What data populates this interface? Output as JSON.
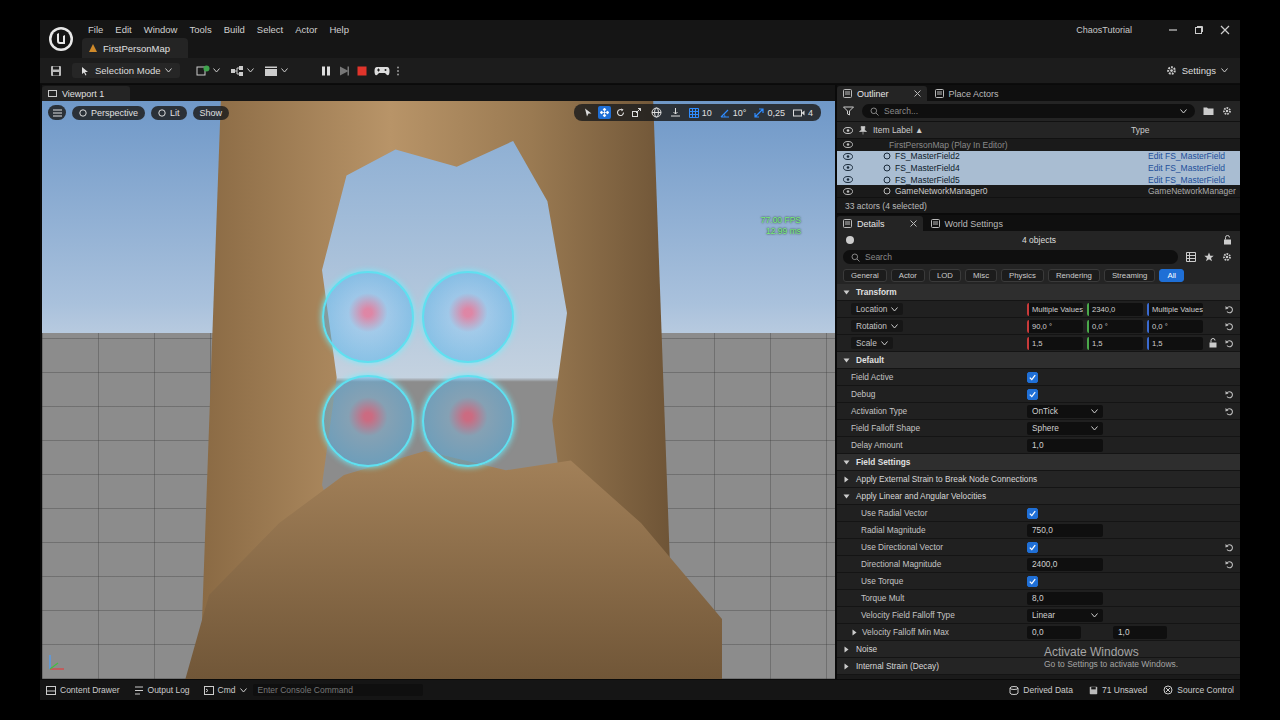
{
  "window": {
    "project": "ChaosTutorial",
    "level_tab": "FirstPersonMap"
  },
  "menu": [
    "File",
    "Edit",
    "Window",
    "Tools",
    "Build",
    "Select",
    "Actor",
    "Help"
  ],
  "toolbar": {
    "mode": "Selection Mode",
    "settings": "Settings"
  },
  "viewport": {
    "tab": "Viewport 1",
    "view_buttons": [
      "Perspective",
      "Lit",
      "Show"
    ],
    "tools": [
      {
        "kind": "select",
        "selected": false
      },
      {
        "kind": "move",
        "selected": true
      },
      {
        "kind": "rotate",
        "selected": false
      },
      {
        "kind": "scale",
        "selected": false
      }
    ],
    "snaps": [
      {
        "kind": "grid",
        "value": "10",
        "selected": true
      },
      {
        "kind": "angle",
        "value": "10°",
        "selected": true
      },
      {
        "kind": "scale",
        "value": "0,25",
        "selected": true
      },
      {
        "kind": "camera",
        "value": "4",
        "selected": false
      }
    ],
    "stats": [
      "77.00 FPS",
      "12.99 ms"
    ]
  },
  "outliner": {
    "tabs": [
      {
        "label": "Outliner",
        "selected": true,
        "closable": true
      },
      {
        "label": "Place Actors",
        "selected": false,
        "closable": false
      }
    ],
    "search_placeholder": "Search...",
    "columns": [
      {
        "label": "Item Label",
        "sort": "▲"
      },
      {
        "label": "Type",
        "sort": ""
      }
    ],
    "rows": [
      {
        "kind": "level",
        "label": "FirstPersonMap (Play In Editor)",
        "type": "",
        "selected": false
      },
      {
        "kind": "actor",
        "label": "FS_MasterField2",
        "type": "Edit FS_MasterField",
        "selected": true
      },
      {
        "kind": "actor",
        "label": "FS_MasterField4",
        "type": "Edit FS_MasterField",
        "selected": true
      },
      {
        "kind": "actor",
        "label": "FS_MasterField5",
        "type": "Edit FS_MasterField",
        "selected": true
      },
      {
        "kind": "actor",
        "label": "GameNetworkManager0",
        "type": "GameNetworkManager",
        "selected": false
      }
    ],
    "footer": "33 actors (4 selected)"
  },
  "details": {
    "tabs": [
      {
        "label": "Details",
        "selected": true,
        "closable": true
      },
      {
        "label": "World Settings",
        "selected": false,
        "closable": false
      }
    ],
    "objects": "4 objects",
    "search_placeholder": "Search",
    "filters": [
      {
        "label": "General",
        "selected": false
      },
      {
        "label": "Actor",
        "selected": false
      },
      {
        "label": "LOD",
        "selected": false
      },
      {
        "label": "Misc",
        "selected": false
      },
      {
        "label": "Physics",
        "selected": false
      },
      {
        "label": "Rendering",
        "selected": false
      },
      {
        "label": "Streaming",
        "selected": false
      },
      {
        "label": "All",
        "selected": true
      }
    ],
    "sections": [
      {
        "label": "Transform",
        "expanded": true,
        "rows": [
          {
            "kind": "vector",
            "label": "Location",
            "values": [
              "Multiple Values",
              "2340,0",
              "Multiple Values"
            ],
            "reset": true,
            "lockable": false,
            "locked": false
          },
          {
            "kind": "vector",
            "label": "Rotation",
            "values": [
              "90,0 °",
              "0,0 °",
              "0,0 °"
            ],
            "reset": true,
            "lockable": false,
            "locked": false
          },
          {
            "kind": "vector",
            "label": "Scale",
            "values": [
              "1,5",
              "1,5",
              "1,5"
            ],
            "reset": true,
            "lockable": true,
            "locked": false
          }
        ]
      },
      {
        "label": "Default",
        "expanded": true,
        "rows": [
          {
            "kind": "check",
            "label": "Field Active",
            "checked": true,
            "reset": false
          },
          {
            "kind": "check",
            "label": "Debug",
            "checked": true,
            "reset": true
          },
          {
            "kind": "dropdown",
            "label": "Activation Type",
            "value": "OnTick",
            "reset": true
          },
          {
            "kind": "dropdown",
            "label": "Field Falloff Shape",
            "value": "Sphere",
            "reset": false
          },
          {
            "kind": "number",
            "label": "Delay Amount",
            "value": "1,0",
            "reset": false
          }
        ]
      },
      {
        "label": "Field Settings",
        "expanded": true,
        "rows": [
          {
            "kind": "group",
            "label": "Apply External Strain to Break Node Connections",
            "expanded": false,
            "rows": []
          },
          {
            "kind": "group",
            "label": "Apply Linear and Angular Velocities",
            "expanded": true,
            "rows": [
              {
                "kind": "check",
                "label": "Use Radial Vector",
                "checked": true,
                "reset": false
              },
              {
                "kind": "number",
                "label": "Radial Magnitude",
                "value": "750,0",
                "reset": false
              },
              {
                "kind": "check",
                "label": "Use Directional Vector",
                "checked": true,
                "reset": true
              },
              {
                "kind": "number",
                "label": "Directional Magnitude",
                "value": "2400,0",
                "reset": true
              },
              {
                "kind": "check",
                "label": "Use Torque",
                "checked": true,
                "reset": false
              },
              {
                "kind": "number",
                "label": "Torque Mult",
                "value": "8,0",
                "reset": false
              },
              {
                "kind": "dropdown",
                "label": "Velocity Field Falloff Type",
                "value": "Linear",
                "reset": false
              },
              {
                "kind": "range",
                "label": "Velocity Falloff Min Max",
                "values": [
                  "0,0",
                  "1,0"
                ],
                "expanded": false,
                "reset": false
              }
            ]
          },
          {
            "kind": "group",
            "label": "Noise",
            "expanded": false,
            "rows": []
          },
          {
            "kind": "group",
            "label": "Internal Strain (Decay)",
            "expanded": false,
            "rows": []
          }
        ]
      }
    ]
  },
  "watermark": {
    "title": "Activate Windows",
    "subtitle": "Go to Settings to activate Windows."
  },
  "status_bar": {
    "left": [
      "Content Drawer",
      "Output Log"
    ],
    "cmd": "Cmd",
    "console_placeholder": "Enter Console Command",
    "right": [
      "Derived Data",
      "71 Unsaved",
      "Source Control"
    ]
  }
}
